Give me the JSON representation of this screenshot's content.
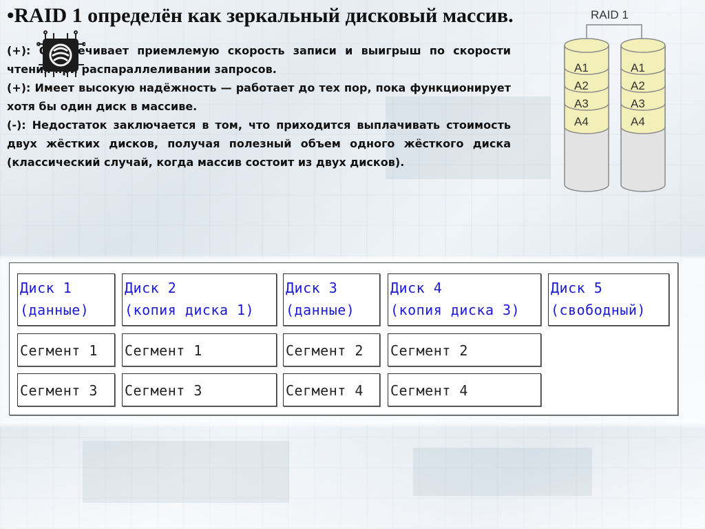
{
  "slide": {
    "title": "•RAID 1 определён как зеркальный дисковый массив.",
    "paragraphs": [
      "(+): Обеспечивает приемлемую скорость записи и выигрыш по скорости чтения при распараллеливании запросов.",
      "(+): Имеет высокую надёжность — работает до тех пор, пока функционирует хотя бы один диск в массиве.",
      "(-): Недостаток заключается в том, что приходится выплачивать стоимость двух жёстких дисков, получая полезный объем одного жёсткого диска (классический случай, когда массив состоит из двух дисков)."
    ]
  },
  "raid_diagram": {
    "label": "RAID 1",
    "disks": [
      {
        "blocks": [
          "A1",
          "A2",
          "A3",
          "A4"
        ]
      },
      {
        "blocks": [
          "A1",
          "A2",
          "A3",
          "A4"
        ]
      }
    ],
    "colors": {
      "block_fill": "#f3efb8",
      "disk_fill": "#e3e3e3",
      "stroke": "#8a8a8a"
    }
  },
  "disk_table": {
    "headers": [
      {
        "line1": "Диск 1",
        "line2": "(данные)"
      },
      {
        "line1": "Диск 2",
        "line2": "(копия диска 1)"
      },
      {
        "line1": "Диск 3",
        "line2": "(данные)"
      },
      {
        "line1": "Диск 4",
        "line2": "(копия диска 3)"
      },
      {
        "line1": "Диск 5",
        "line2": "(свободный)"
      }
    ],
    "rows": [
      [
        "Сегмент 1",
        "Сегмент 1",
        "Сегмент 2",
        "Сегмент 2"
      ],
      [
        "Сегмент 3",
        "Сегмент 3",
        "Сегмент 4",
        "Сегмент 4"
      ]
    ],
    "colors": {
      "header_text": "#1a1ad6",
      "cell_text": "#222222"
    }
  }
}
